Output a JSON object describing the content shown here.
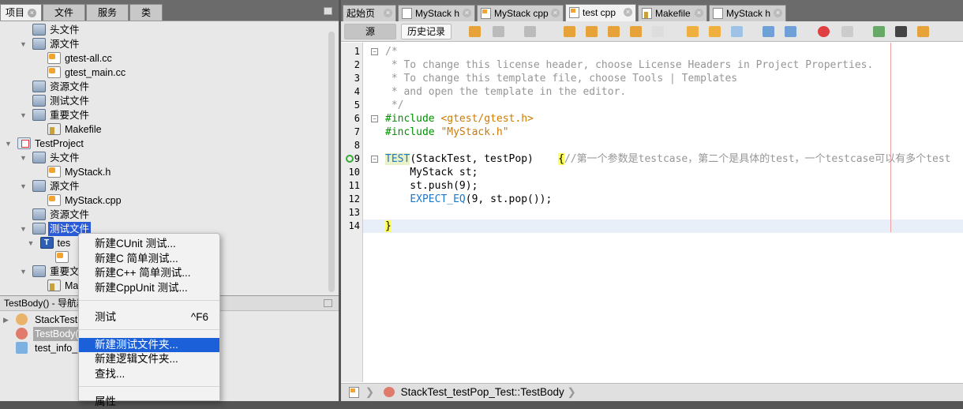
{
  "left_tabs": [
    {
      "label": "项目",
      "active": true
    },
    {
      "label": "文件"
    },
    {
      "label": "服务"
    },
    {
      "label": "类"
    }
  ],
  "tree": [
    {
      "label": "头文件",
      "icon": "folder-icon",
      "level": 1
    },
    {
      "label": "源文件",
      "icon": "folder-icon",
      "level": 1,
      "expanded": true
    },
    {
      "label": "gtest-all.cc",
      "icon": "cc-file-icon",
      "level": 2
    },
    {
      "label": "gtest_main.cc",
      "icon": "cc-file-icon",
      "level": 2
    },
    {
      "label": "资源文件",
      "icon": "folder-icon",
      "level": 1
    },
    {
      "label": "测试文件",
      "icon": "test-folder-icon",
      "level": 1
    },
    {
      "label": "重要文件",
      "icon": "folder-icon",
      "level": 1,
      "expanded": true
    },
    {
      "label": "Makefile",
      "icon": "makefile-icon",
      "level": 2
    },
    {
      "label": "TestProject",
      "icon": "project-icon",
      "level": 0,
      "expanded": true
    },
    {
      "label": "头文件",
      "icon": "folder-icon",
      "level": 1,
      "expanded": true
    },
    {
      "label": "MyStack.h",
      "icon": "h-file-icon",
      "level": 2
    },
    {
      "label": "源文件",
      "icon": "folder-icon",
      "level": 1,
      "expanded": true
    },
    {
      "label": "MyStack.cpp",
      "icon": "cc-file-icon",
      "level": 2
    },
    {
      "label": "资源文件",
      "icon": "folder-icon",
      "level": 1
    },
    {
      "label": "测试文件",
      "icon": "test-folder-icon",
      "level": 1,
      "expanded": true,
      "selected": true
    },
    {
      "label": "tes",
      "icon": "test-icon",
      "level": 1.5,
      "expanded": true
    },
    {
      "label": "",
      "icon": "cc-file-icon",
      "level": 2.5
    },
    {
      "label": "重要文",
      "icon": "folder-icon",
      "level": 1,
      "expanded": true
    },
    {
      "label": "Ma",
      "icon": "makefile-icon",
      "level": 2
    }
  ],
  "navigator": {
    "title": "TestBody() - 导航器",
    "items": [
      {
        "label": "StackTest",
        "icon": "class-icon",
        "collapsed": true
      },
      {
        "label": "TestBody(",
        "icon": "method-icon",
        "selected": true
      },
      {
        "label": "test_info_",
        "icon": "field-icon"
      }
    ]
  },
  "editor_tabs": [
    {
      "label": "起始页"
    },
    {
      "label": "MyStack h",
      "icon": "h"
    },
    {
      "label": "MyStack cpp",
      "icon": "c"
    },
    {
      "label": "test cpp",
      "icon": "c",
      "active": true
    },
    {
      "label": "Makefile",
      "icon": "m"
    },
    {
      "label": "MyStack h",
      "icon": "h"
    }
  ],
  "toolbar": {
    "source": "源",
    "history": "历史记录"
  },
  "code": [
    "/*",
    " * To change this license header, choose License Headers in Project Properties.",
    " * To change this template file, choose Tools | Templates",
    " * and open the template in the editor.",
    " */",
    "#include <gtest/gtest.h>",
    "#include \"MyStack.h\"",
    "",
    "TEST(StackTest, testPop)    {//第一个参数是testcase，第二个是具体的test，一个testcase可以有多个test",
    "    MyStack st;",
    "    st.push(9);",
    "    EXPECT_EQ(9, st.pop());",
    "",
    "}"
  ],
  "status": {
    "breadcrumb": "StackTest_testPop_Test::TestBody"
  },
  "context_menu": [
    {
      "label": "新建CUnit 测试..."
    },
    {
      "label": "新建C 简单测试..."
    },
    {
      "label": "新建C++ 简单测试..."
    },
    {
      "label": "新建CppUnit 测试..."
    },
    {
      "sep": true
    },
    {
      "label": "测试",
      "shortcut": "^F6"
    },
    {
      "sep": true
    },
    {
      "label": "新建测试文件夹...",
      "highlighted": true
    },
    {
      "label": "新建逻辑文件夹..."
    },
    {
      "label": "查找..."
    },
    {
      "sep": true
    },
    {
      "label": "属性"
    }
  ],
  "colors": {
    "selection": "#2a5bd7",
    "menu_highlight": "#1b5fd9",
    "comment": "#969696",
    "preprocessor": "#009100",
    "string": "#ce7b00",
    "macro": "#1e78c8"
  }
}
